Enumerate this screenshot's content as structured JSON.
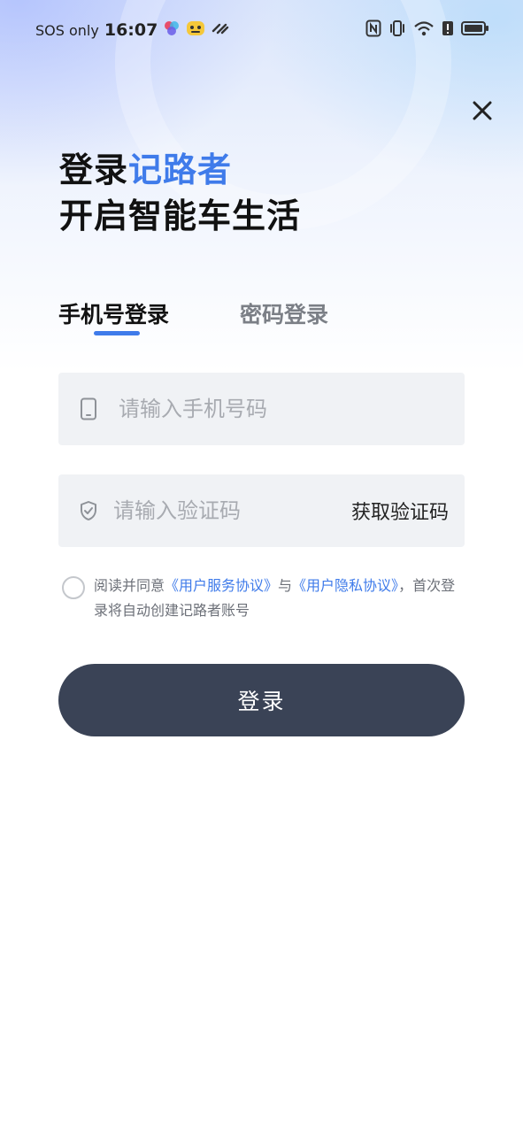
{
  "status_bar": {
    "carrier": "SOS only",
    "time": "16:07"
  },
  "header": {
    "title_prefix": "登录",
    "title_brand": "记路者",
    "subtitle": "开启智能车生活"
  },
  "tabs": [
    {
      "label": "手机号登录",
      "active": true
    },
    {
      "label": "密码登录",
      "active": false
    }
  ],
  "form": {
    "phone_placeholder": "请输入手机号码",
    "code_placeholder": "请输入验证码",
    "get_code_label": "获取验证码"
  },
  "agreement": {
    "prefix": "阅读并同意",
    "user_service": "《用户服务协议》",
    "connector": "与",
    "privacy": "《用户隐私协议》",
    "suffix": "，首次登录将自动创建记路者账号"
  },
  "login_button": "登录",
  "colors": {
    "accent": "#3f7bea",
    "button_bg": "#3a4356",
    "input_bg": "#f0f2f5"
  },
  "icons": {
    "close": "close-icon",
    "phone": "phone-icon",
    "shield": "shield-check-icon"
  }
}
